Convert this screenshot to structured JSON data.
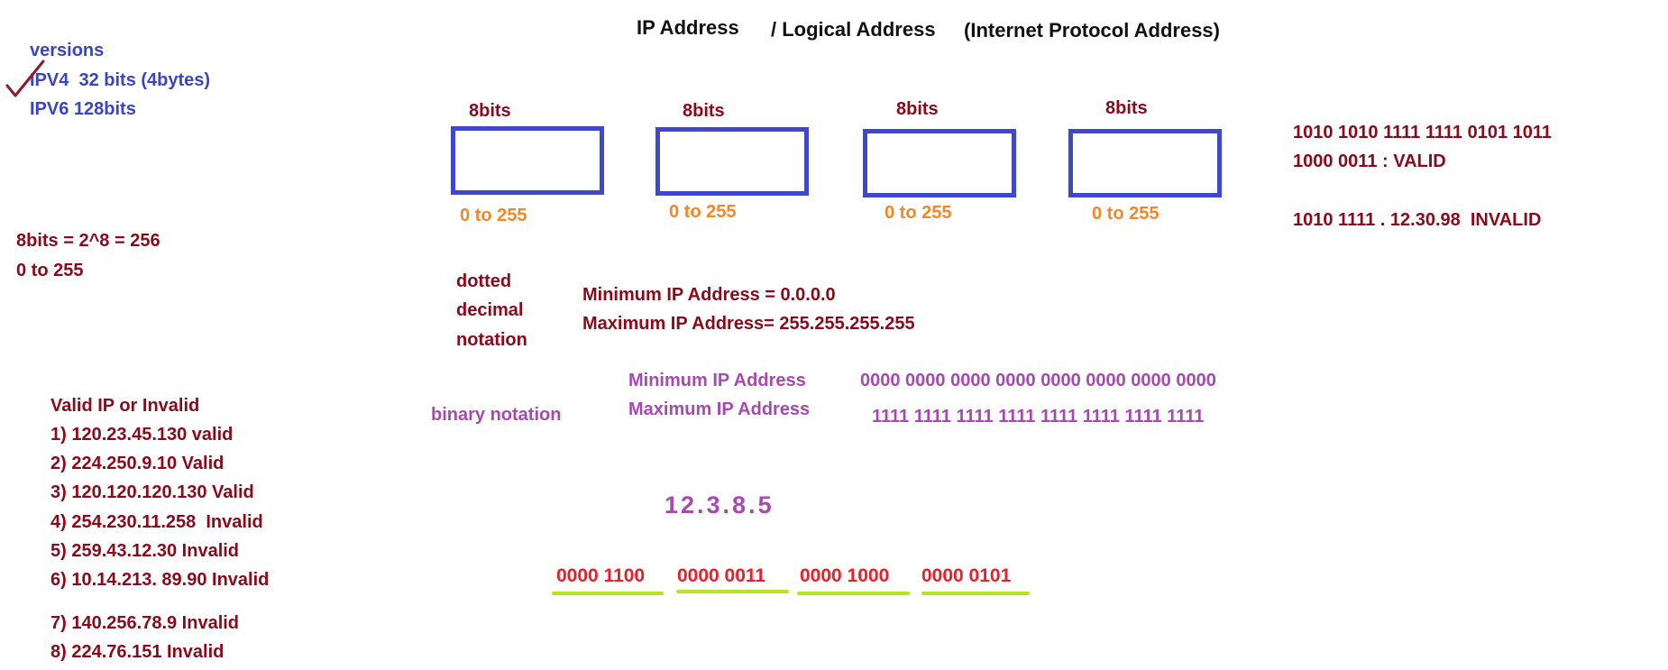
{
  "title": {
    "part1": "IP Address",
    "part2": "/ Logical Address",
    "part3": "(Internet Protocol Address)"
  },
  "versions": {
    "heading": "versions",
    "items": [
      "IPV4  32 bits (4bytes)",
      "IPV6 128bits"
    ]
  },
  "octets": [
    {
      "bits": "8bits",
      "range": "0 to 255"
    },
    {
      "bits": "8bits",
      "range": "0 to 255"
    },
    {
      "bits": "8bits",
      "range": "0 to 255"
    },
    {
      "bits": "8bits",
      "range": "0 to 255"
    }
  ],
  "binary_checks": {
    "valid_line1": "1010 1010 1111 1111 0101 1011",
    "valid_line2": "1000 0011 : VALID",
    "invalid": "1010 1111 . 12.30.98  INVALID"
  },
  "eight_bits": {
    "formula": "8bits = 2^8 = 256",
    "range": "0 to 255"
  },
  "dotted": {
    "label": [
      "dotted",
      "decimal",
      "notation"
    ],
    "min": "Minimum IP Address = 0.0.0.0",
    "max": "Maximum IP Address= 255.255.255.255"
  },
  "binary": {
    "label": "binary notation",
    "min_label": "Minimum IP Address",
    "min_value": "0000 0000 0000 0000 0000 0000 0000 0000",
    "max_label": "Maximum IP Address",
    "max_value": "1111 1111 1111 1111 1111 1111 1111 1111"
  },
  "validity": {
    "heading": "Valid IP or Invalid",
    "items": [
      "1) 120.23.45.130 valid",
      "2) 224.250.9.10 Valid",
      "3) 120.120.120.130 Valid",
      "4) 254.230.11.258  Invalid",
      "5) 259.43.12.30 Invalid",
      "6) 10.14.213. 89.90 Invalid",
      "7) 140.256.78.9 Invalid",
      "8) 224.76.151 Invalid"
    ]
  },
  "example": {
    "ip": "12.3.8.5",
    "groups": [
      "0000 1100",
      "0000 0011",
      "0000 1000",
      "0000 0101"
    ]
  },
  "colors": {
    "dark_red": "#8b0a1a",
    "blue": "#3a44c6",
    "orange": "#f5872a",
    "purple": "#a64ab0",
    "red": "#e8202a",
    "box_border": "#3f48cc",
    "underline": "#b5e61d",
    "checkmark": "#8b1a2a"
  }
}
